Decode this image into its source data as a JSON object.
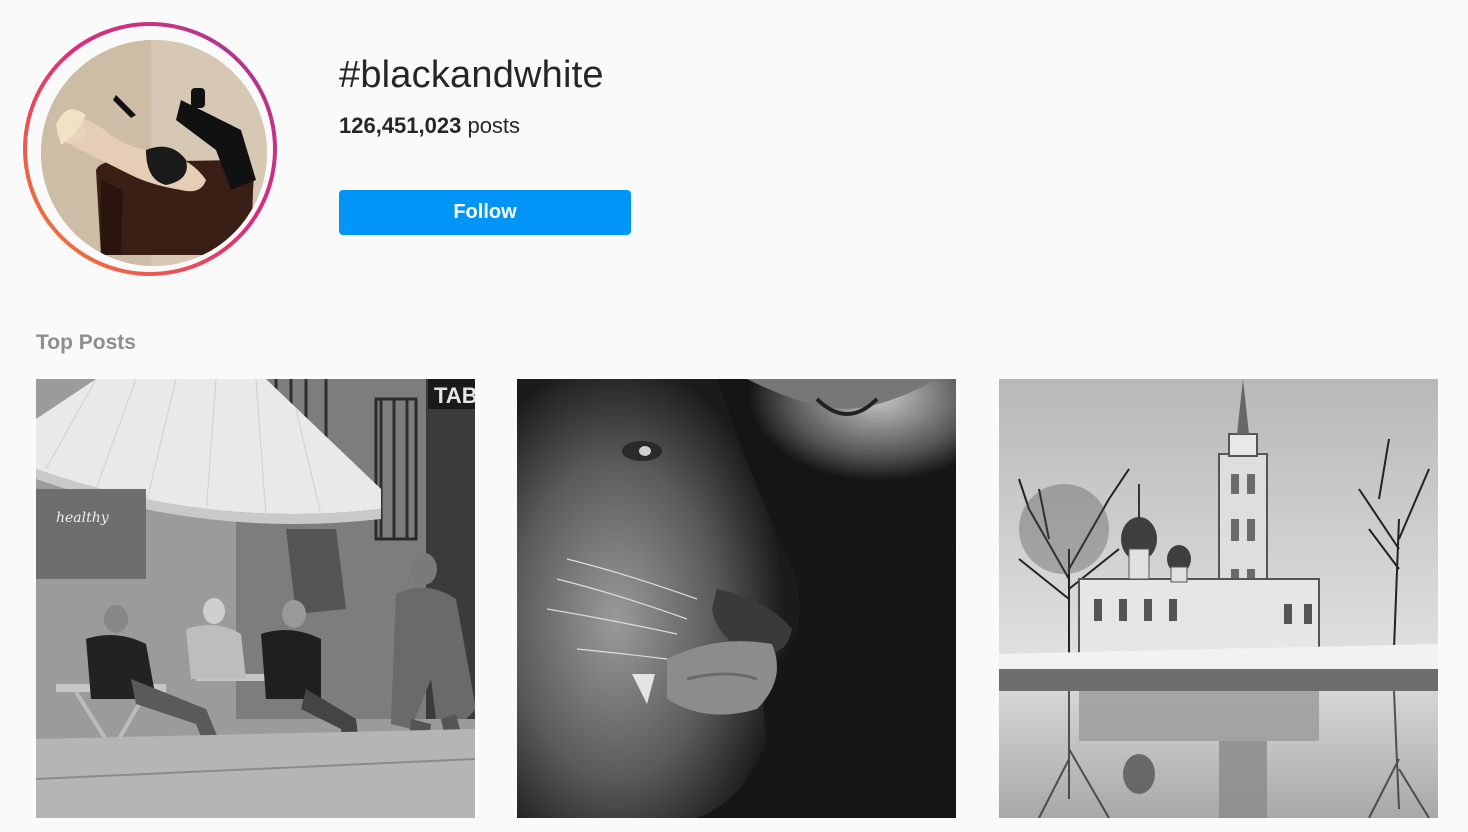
{
  "header": {
    "hashtag": "#blackandwhite",
    "post_count": "126,451,023",
    "post_count_suffix": " posts",
    "follow_label": "Follow"
  },
  "top_posts": {
    "title": "Top Posts",
    "posts": [
      {
        "subject": "street-cafe-photo",
        "sign_text": "healthy",
        "shop_text": "TAB"
      },
      {
        "subject": "lion-closeup-photo"
      },
      {
        "subject": "church-reflection-photo"
      }
    ]
  },
  "colors": {
    "accent": "#0095f6",
    "ring_start": "#f58529",
    "ring_end": "#c13584",
    "muted_text": "#8e8e8e",
    "background": "#fafafa"
  }
}
